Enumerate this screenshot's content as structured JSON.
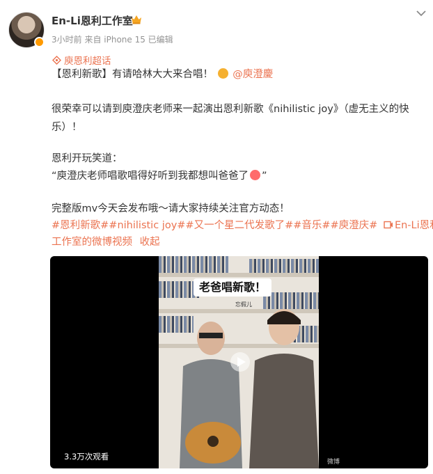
{
  "post": {
    "author": "En-Li恩利工作室",
    "meta": "3小时前  来自 iPhone 15  已编辑",
    "super_topic": "庾恩利超话",
    "line1_a": "【恩利新歌】有请哈林大大来合唱！",
    "line1_mention": "@庾澄慶",
    "line2": "很荣幸可以请到庾澄庆老师来一起演出恩利新歌《nihilistic joy》（虚无主义的快",
    "line3": "乐）！",
    "line4": "恩利开玩笑道：",
    "line5": "“庾澄庆老师唱歌唱得好听到我都想叫爸爸了",
    "line5_end": "”",
    "line6": "完整版mv今天会发布哦～请大家持续关注官方动态！",
    "tags_line1": "#恩利新歌##nihilistic joy##又一个星二代发歌了##音乐##庾澄庆#",
    "video_link_a": "En-Li恩利",
    "tags_line2_a": "工作室的微博视频",
    "collapse": "收起"
  },
  "video": {
    "caption": "老爸唱新歌！",
    "small_tag": "忘假儿",
    "views": "3.3万次观看"
  },
  "watermark": "微博",
  "colors": {
    "accent": "#eb7350",
    "text": "#333333",
    "meta": "#939393"
  },
  "icons": [
    "crown-icon",
    "chevron-down-icon",
    "supertopic-icon",
    "video-link-icon",
    "play-icon"
  ]
}
